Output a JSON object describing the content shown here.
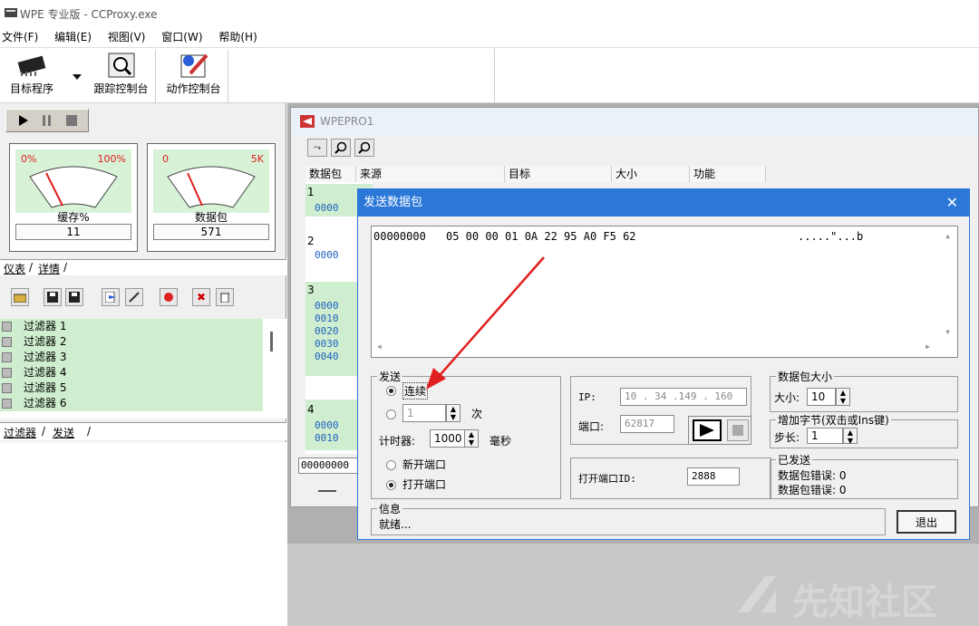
{
  "window": {
    "title": "WPE 专业版 - CCProxy.exe"
  },
  "menu": {
    "items": [
      "文件(F)",
      "编辑(E)",
      "视图(V)",
      "窗口(W)",
      "帮助(H)"
    ]
  },
  "toolbar": {
    "target_label": "目标程序",
    "trace_label": "跟踪控制台",
    "action_label": "动作控制台"
  },
  "gauges": {
    "buffer": {
      "min": "0%",
      "max": "100%",
      "label": "缓存%",
      "value": "11"
    },
    "packets": {
      "min": "0",
      "max": "5K",
      "label": "数据包",
      "value": "571"
    }
  },
  "left_tabs": {
    "meter": "仪表",
    "details": "详情"
  },
  "filters": {
    "items": [
      "过滤器 1",
      "过滤器 2",
      "过滤器 3",
      "过滤器 4",
      "过滤器 5",
      "过滤器 6"
    ]
  },
  "bottom_tabs": {
    "filter": "过滤器",
    "send": "发送"
  },
  "wpepro": {
    "title": "WPEPRO1",
    "columns": [
      "数据包",
      "来源",
      "目标",
      "大小",
      "功能"
    ],
    "packet_numbers": [
      "1",
      "2",
      "3",
      "4"
    ],
    "offsets": [
      "0000",
      "0000",
      "0000",
      "0010",
      "0020",
      "0030",
      "0040",
      "0000",
      "0010"
    ],
    "bottom_field": "00000000"
  },
  "dialog": {
    "title": "发送数据包",
    "hex_offset": "00000000",
    "hex_bytes": "05 00 00 01 0A 22 95 A0 F5 62",
    "hex_ascii": ".....\"...b",
    "send_group": {
      "title": "发送",
      "continuous": "连续",
      "times_value": "1",
      "times_unit": "次",
      "timer_label": "计时器:",
      "timer_value": "1000",
      "timer_unit": "毫秒",
      "new_port": "新开端口",
      "open_port": "打开端口"
    },
    "ip_label": "IP:",
    "ip_value": "10 . 34 .149 . 160",
    "port_label": "端口:",
    "port_value": "62817",
    "open_port_id_label": "打开端口ID:",
    "open_port_id_value": "2888",
    "size_group": {
      "title": "数据包大小",
      "size_label": "大小:",
      "size_value": "10"
    },
    "increment_group": {
      "title": "增加字节(双击或Ins键)",
      "step_label": "步长:",
      "step_value": "1"
    },
    "sent_group": {
      "title": "已发送",
      "line1": "数据包错误: 0",
      "line2": "数据包错误: 0"
    },
    "info_group": {
      "title": "信息",
      "status": "就绪..."
    },
    "exit_label": "退出"
  },
  "watermark": "先知社区",
  "colors": {
    "accent": "#2b78d8",
    "row_green": "#cfeecf",
    "arrow": "#e02020"
  }
}
